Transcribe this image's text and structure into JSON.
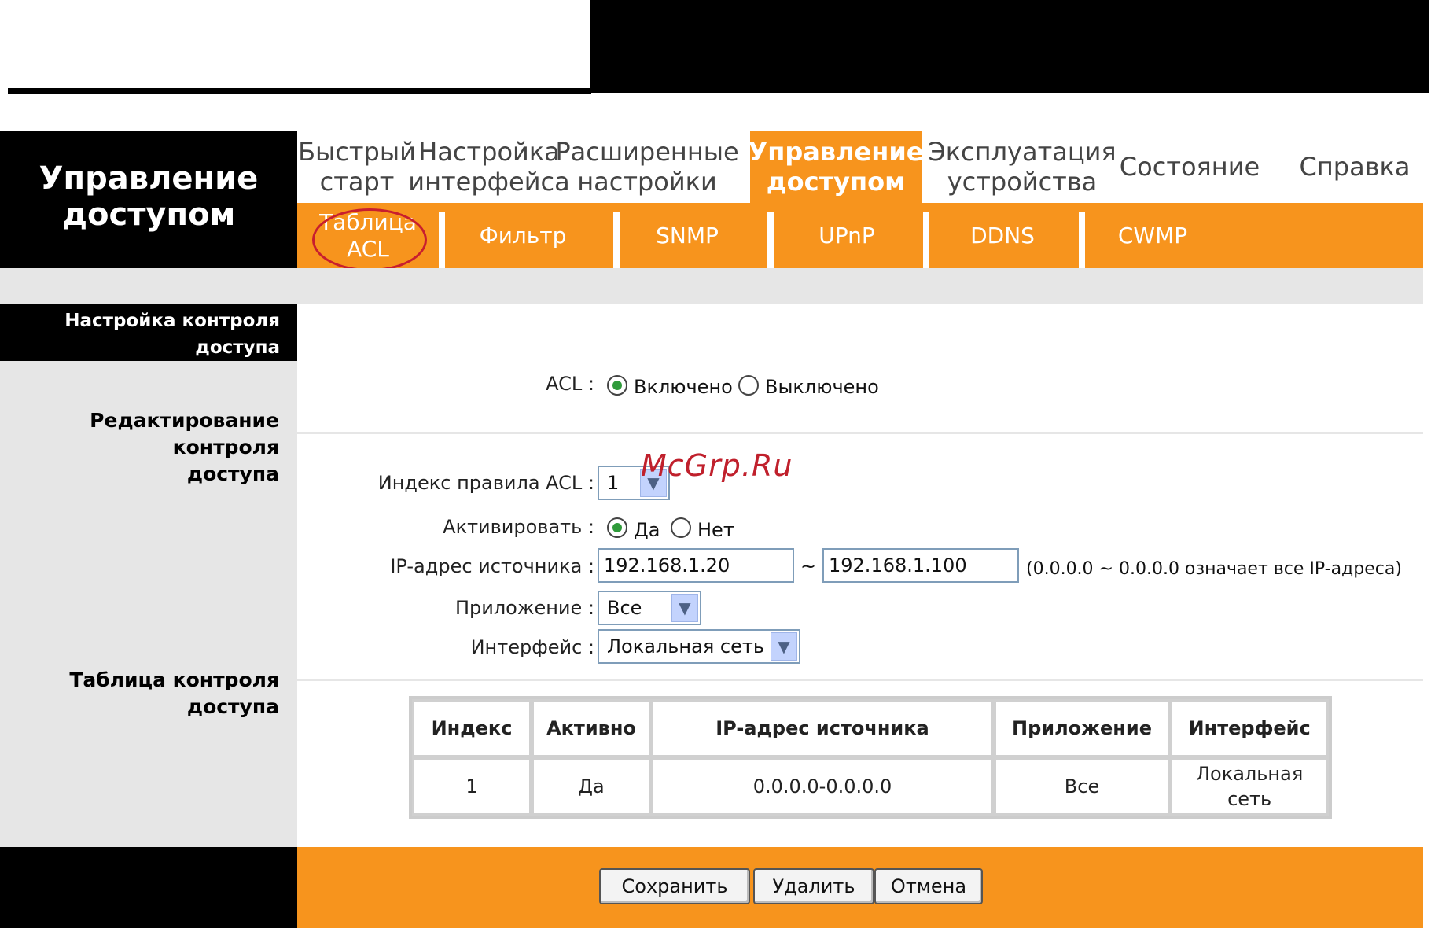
{
  "brand": {
    "line1": "Управление",
    "line2": "доступом"
  },
  "menu": [
    {
      "l1": "Быстрый",
      "l2": "старт"
    },
    {
      "l1": "Настройка",
      "l2": "интерфейса"
    },
    {
      "l1": "Расширенные",
      "l2": "настройки"
    },
    {
      "l1": "Управление",
      "l2": "доступом"
    },
    {
      "l1": "Эксплуатация",
      "l2": "устройства"
    },
    {
      "l1": "Состояние",
      "l2": ""
    },
    {
      "l1": "Справка",
      "l2": ""
    }
  ],
  "submenu": [
    {
      "l1": "Таблица",
      "l2": "ACL"
    },
    {
      "l1": "Фильтр"
    },
    {
      "l1": "SNMP"
    },
    {
      "l1": "UPnP"
    },
    {
      "l1": "DDNS"
    },
    {
      "l1": "CWMP"
    }
  ],
  "sections": {
    "access_settings_l1": "Настройка контроля",
    "access_settings_l2": "доступа",
    "edit_l1": "Редактирование контроля",
    "edit_l2": "доступа",
    "table": "Таблица контроля доступа"
  },
  "acl": {
    "label": "ACL :",
    "on": "Включено",
    "off": "Выключено",
    "selected": "on"
  },
  "form": {
    "index_label": "Индекс правила ACL :",
    "index_value": "1",
    "activate_label": "Активировать :",
    "yes": "Да",
    "no": "Нет",
    "ip_label": "IP-адрес источника :",
    "ip_from": "192.168.1.20",
    "tilde": "~",
    "ip_to": "192.168.1.100",
    "ip_hint": "(0.0.0.0 ~ 0.0.0.0 означает все IP-адреса)",
    "app_label": "Приложение :",
    "app_value": "Все",
    "iface_label": "Интерфейс :",
    "iface_value": "Локальная сеть"
  },
  "table": {
    "headers": [
      "Индекс",
      "Активно",
      "IP-адрес источника",
      "Приложение",
      "Интерфейс"
    ],
    "rows": [
      [
        "1",
        "Да",
        "0.0.0.0-0.0.0.0",
        "Все",
        "Локальная сеть"
      ]
    ]
  },
  "buttons": {
    "save": "Сохранить",
    "delete": "Удалить",
    "cancel": "Отмена"
  },
  "watermark": "McGrp.Ru",
  "colors": {
    "accent": "#f7941d",
    "highlight_circle": "#c81e2e"
  }
}
